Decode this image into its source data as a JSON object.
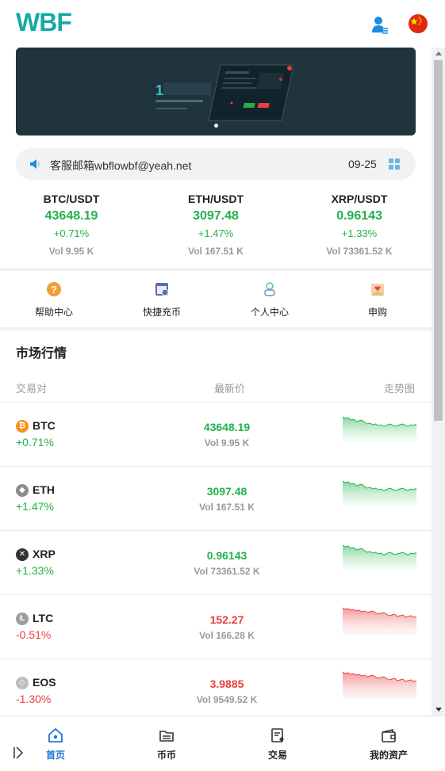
{
  "header": {
    "logo_text": "WBF",
    "colors": {
      "brand": "#17a9a4",
      "up": "#22b14c",
      "down": "#e94040",
      "active_tab": "#1a76d2"
    }
  },
  "notice": {
    "text": "客服邮箱wbflowbf@yeah.net",
    "date": "09-25"
  },
  "tickers": [
    {
      "pair": "BTC/USDT",
      "price": "43648.19",
      "change": "+0.71%",
      "volume": "Vol 9.95 K"
    },
    {
      "pair": "ETH/USDT",
      "price": "3097.48",
      "change": "+1.47%",
      "volume": "Vol 167.51 K"
    },
    {
      "pair": "XRP/USDT",
      "price": "0.96143",
      "change": "+1.33%",
      "volume": "Vol 73361.52 K"
    }
  ],
  "quick_links": [
    {
      "label": "帮助中心",
      "icon": "help-icon"
    },
    {
      "label": "快捷充币",
      "icon": "deposit-icon"
    },
    {
      "label": "个人中心",
      "icon": "profile-icon"
    },
    {
      "label": "申购",
      "icon": "subscribe-icon"
    }
  ],
  "market": {
    "title": "市场行情",
    "columns": {
      "pair": "交易对",
      "price": "最新价",
      "trend": "走势图"
    },
    "rows": [
      {
        "symbol": "BTC",
        "change": "+0.71%",
        "price": "43648.19",
        "volume": "Vol 9.95 K",
        "direction": "up",
        "icon": "bitcoin-icon"
      },
      {
        "symbol": "ETH",
        "change": "+1.47%",
        "price": "3097.48",
        "volume": "Vol 167.51 K",
        "direction": "up",
        "icon": "ethereum-icon"
      },
      {
        "symbol": "XRP",
        "change": "+1.33%",
        "price": "0.96143",
        "volume": "Vol 73361.52 K",
        "direction": "up",
        "icon": "xrp-icon"
      },
      {
        "symbol": "LTC",
        "change": "-0.51%",
        "price": "152.27",
        "volume": "Vol 166.28 K",
        "direction": "down",
        "icon": "litecoin-icon"
      },
      {
        "symbol": "EOS",
        "change": "-1.30%",
        "price": "3.9885",
        "volume": "Vol 9549.52 K",
        "direction": "down",
        "icon": "eos-icon"
      }
    ]
  },
  "tabbar": [
    {
      "label": "首页",
      "icon": "home-icon",
      "active": true
    },
    {
      "label": "币币",
      "icon": "coin-icon",
      "active": false
    },
    {
      "label": "交易",
      "icon": "trade-icon",
      "active": false
    },
    {
      "label": "我的资产",
      "icon": "wallet-icon",
      "active": false
    }
  ]
}
